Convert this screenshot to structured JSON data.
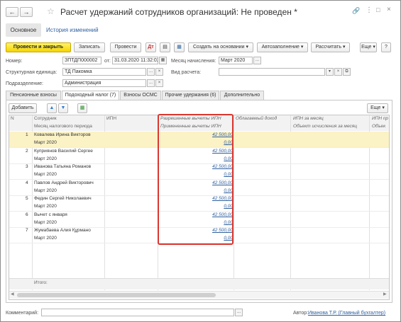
{
  "window": {
    "title": "Расчет удержаний сотрудников организаций: Не проведен *"
  },
  "nav_tabs": [
    {
      "label": "Основное"
    },
    {
      "label": "История изменений"
    }
  ],
  "toolbar": {
    "post_close": "Провести и закрыть",
    "save": "Записать",
    "post": "Провести",
    "create_based": "Создать на основании",
    "autofill": "Автозаполнение",
    "calculate": "Рассчитать",
    "more": "Еще",
    "help": "?"
  },
  "header_fields": {
    "number_label": "Номер:",
    "number_value": "ЗПТДП000002",
    "from_label": "от:",
    "date_value": "31.03.2020 11:32:02",
    "month_label": "Месяц начисления:",
    "month_value": "Март 2020",
    "unit_label": "Структурная единица:",
    "unit_value": "ТД Пакомка",
    "calc_type_label": "Вид расчета:",
    "calc_type_value": "",
    "division_label": "Подразделение:",
    "division_value": "Администрация"
  },
  "content_tabs": [
    {
      "label": "Пенсионные взносы"
    },
    {
      "label": "Подоходный налог (7)"
    },
    {
      "label": "Взносы ОСМС"
    },
    {
      "label": "Прочие удержания (6)"
    },
    {
      "label": "Дополнительно"
    }
  ],
  "table_toolbar": {
    "add": "Добавить",
    "more": "Еще"
  },
  "table": {
    "headers_row1": [
      "N",
      "Сотрудник",
      "ИПН",
      "Разрешенные вычеты ИПН",
      "Облагаемый доход",
      "ИПН за месяц",
      "ИПН пр"
    ],
    "headers_row2": [
      "Месяц налогового периода",
      "Примененные вычеты ИПН",
      "Объект исчисления за месяц",
      "Объек"
    ],
    "rows": [
      {
        "n": "1",
        "employee": "Ковалева Ирина Викторов",
        "month": "Март 2020",
        "allowed": "42 500,00",
        "applied": "0,00"
      },
      {
        "n": "2",
        "employee": "Куприянов Василий Сергее",
        "month": "Март 2020",
        "allowed": "42 500,00",
        "applied": "0,00"
      },
      {
        "n": "3",
        "employee": "Иванова Татьяна Романов",
        "month": "Март 2020",
        "allowed": "42 500,00",
        "applied": "0,00"
      },
      {
        "n": "4",
        "employee": "Павлов Андрей Викторович",
        "month": "Март 2020",
        "allowed": "42 500,00",
        "applied": "0,00"
      },
      {
        "n": "5",
        "employee": "Федин Сергей Николаевич",
        "month": "Март 2020",
        "allowed": "42 500,00",
        "applied": "0,00"
      },
      {
        "n": "6",
        "employee": "Вычет с января",
        "month": "Март 2020",
        "allowed": "42 500,00",
        "applied": "0,00"
      },
      {
        "n": "7",
        "employee": "Жумабаева Алия Құрмано",
        "month": "Март 2020",
        "allowed": "42 500,00",
        "applied": "0,00"
      }
    ],
    "total_label": "Итого:"
  },
  "footer": {
    "comment_label": "Комментарий:",
    "comment_value": "",
    "author_label": "Автор:",
    "author_value": "Иванова Т.Р. (Главный бухгалтер)"
  },
  "icons": {
    "back": "back-arrow-icon",
    "forward": "forward-arrow-icon",
    "star": "star-icon",
    "link": "link-icon",
    "menu": "more-menu-icon",
    "maximize": "maximize-icon",
    "close": "close-icon"
  },
  "colors": {
    "accent_yellow": "#f5d400",
    "selected_row": "#fbf2c6",
    "highlight_border": "#d9372f",
    "link": "#2e5f9e"
  }
}
